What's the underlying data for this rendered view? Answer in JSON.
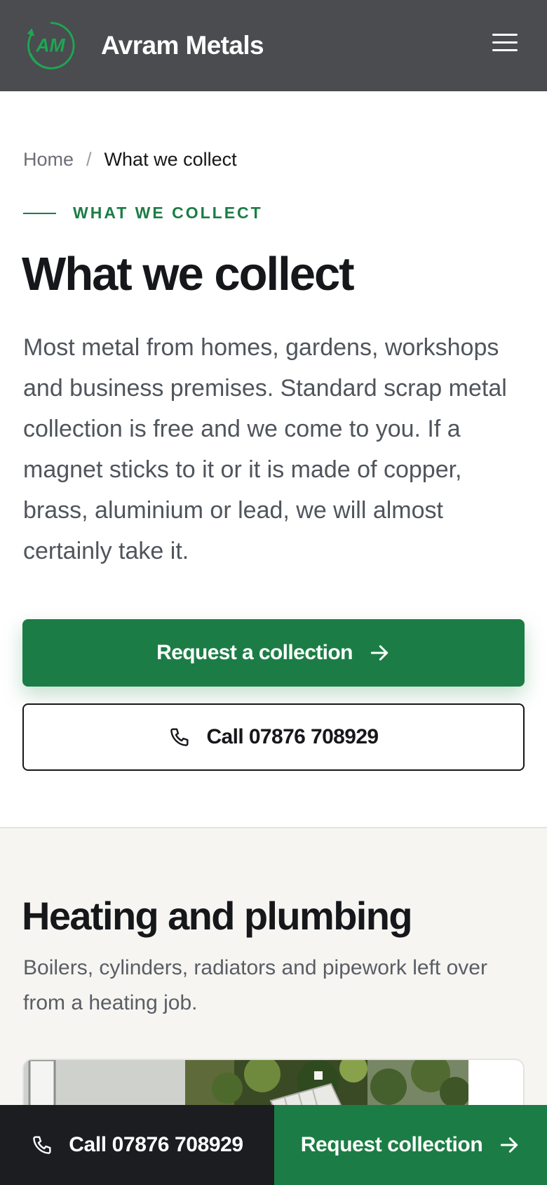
{
  "header": {
    "logo_text": "AM",
    "brand": "Avram Metals",
    "menu_icon": "hamburger-menu-icon"
  },
  "breadcrumb": {
    "home": "Home",
    "separator": "/",
    "current": "What we collect"
  },
  "hero": {
    "eyebrow": "WHAT WE COLLECT",
    "title": "What we collect",
    "lead": "Most metal from homes, gardens, workshops and business premises. Standard scrap metal collection is free and we come to you. If a magnet sticks to it or it is made of copper, brass, aluminium or lead, we will almost certainly take it.",
    "primary_button": "Request a collection",
    "secondary_button": "Call 07876 708929"
  },
  "section": {
    "title": "Heating and plumbing",
    "description": "Boilers, cylinders, radiators and pipework left over from a heating job."
  },
  "sticky": {
    "call": "Call 07876 708929",
    "request": "Request collection"
  },
  "colors": {
    "header_bg": "#4a4c50",
    "accent_green": "#1b7d45",
    "text_dark": "#15171a",
    "sticky_dark": "#1b1d21",
    "section_bg": "#f6f5f2"
  }
}
